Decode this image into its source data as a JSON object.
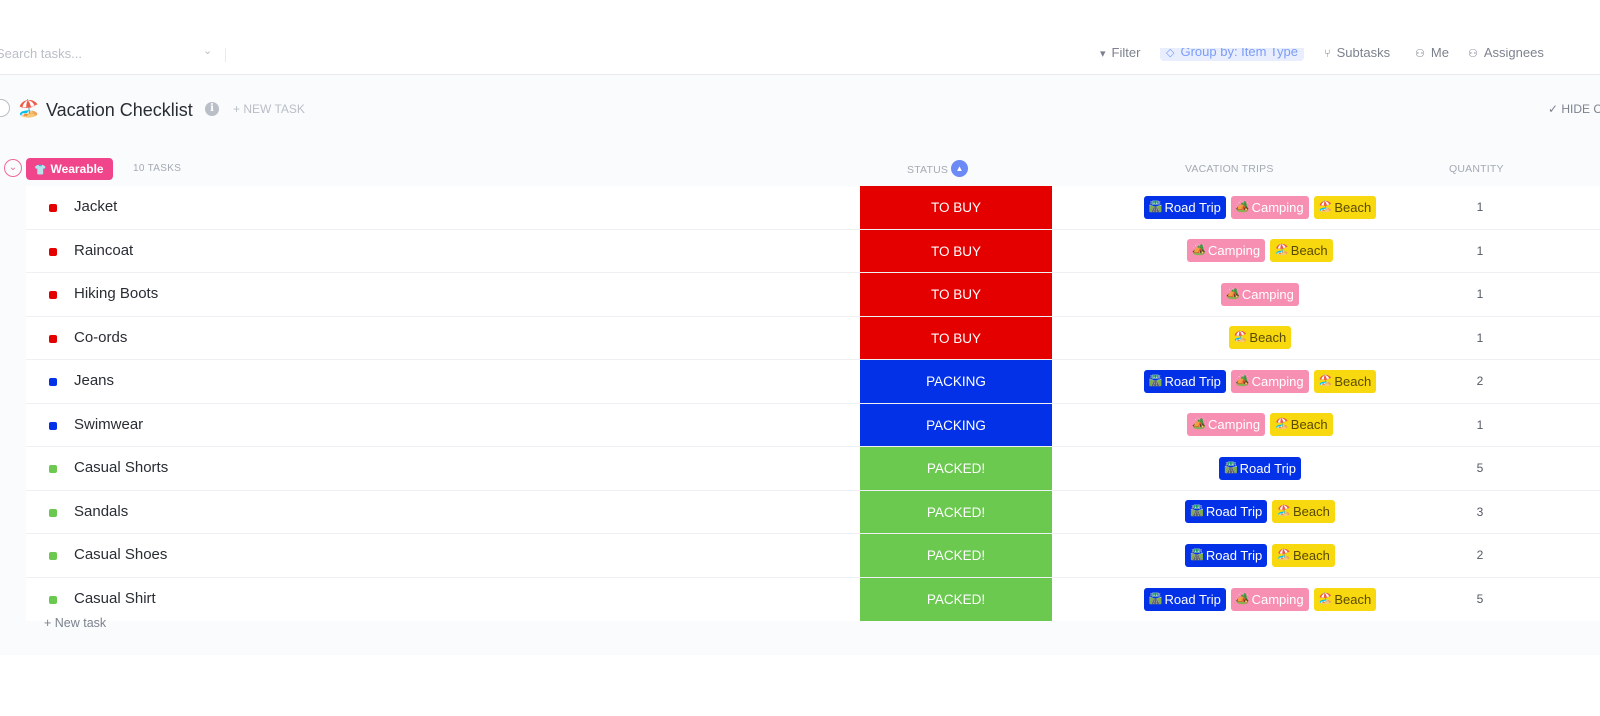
{
  "toolbar": {
    "search_placeholder": "Search tasks...",
    "filter": "Filter",
    "group_by": "Group by: Item Type",
    "subtasks": "Subtasks",
    "me": "Me",
    "assignees": "Assignees"
  },
  "list": {
    "emoji": "🏖️",
    "title": "Vacation Checklist",
    "new_task": "+ NEW TASK",
    "hide_closed": "✓ HIDE C"
  },
  "group": {
    "emoji": "👕",
    "name": "Wearable",
    "count": "10 TASKS",
    "color": "#f0448b"
  },
  "columns": {
    "status": "STATUS",
    "trips": "VACATION TRIPS",
    "quantity": "QUANTITY"
  },
  "trip_emojis": {
    "road_trip": "🛣️",
    "camping": "🏕️",
    "beach": "🏖️"
  },
  "status_colors": {
    "TO BUY": "#e50000",
    "PACKING": "#0231e8",
    "PACKED!": "#6bc950"
  },
  "tasks": [
    {
      "name": "Jacket",
      "status": "TO BUY",
      "trips": [
        "Road Trip",
        "Camping",
        "Beach"
      ],
      "quantity": "1"
    },
    {
      "name": "Raincoat",
      "status": "TO BUY",
      "trips": [
        "Camping",
        "Beach"
      ],
      "quantity": "1"
    },
    {
      "name": "Hiking Boots",
      "status": "TO BUY",
      "trips": [
        "Camping"
      ],
      "quantity": "1"
    },
    {
      "name": "Co-ords",
      "status": "TO BUY",
      "trips": [
        "Beach"
      ],
      "quantity": "1"
    },
    {
      "name": "Jeans",
      "status": "PACKING",
      "trips": [
        "Road Trip",
        "Camping",
        "Beach"
      ],
      "quantity": "2"
    },
    {
      "name": "Swimwear",
      "status": "PACKING",
      "trips": [
        "Camping",
        "Beach"
      ],
      "quantity": "1"
    },
    {
      "name": "Casual Shorts",
      "status": "PACKED!",
      "trips": [
        "Road Trip"
      ],
      "quantity": "5"
    },
    {
      "name": "Sandals",
      "status": "PACKED!",
      "trips": [
        "Road Trip",
        "Beach"
      ],
      "quantity": "3"
    },
    {
      "name": "Casual Shoes",
      "status": "PACKED!",
      "trips": [
        "Road Trip",
        "Beach"
      ],
      "quantity": "2"
    },
    {
      "name": "Casual Shirt",
      "status": "PACKED!",
      "trips": [
        "Road Trip",
        "Camping",
        "Beach"
      ],
      "quantity": "5"
    }
  ],
  "footer": {
    "new_task": "+ New task"
  }
}
